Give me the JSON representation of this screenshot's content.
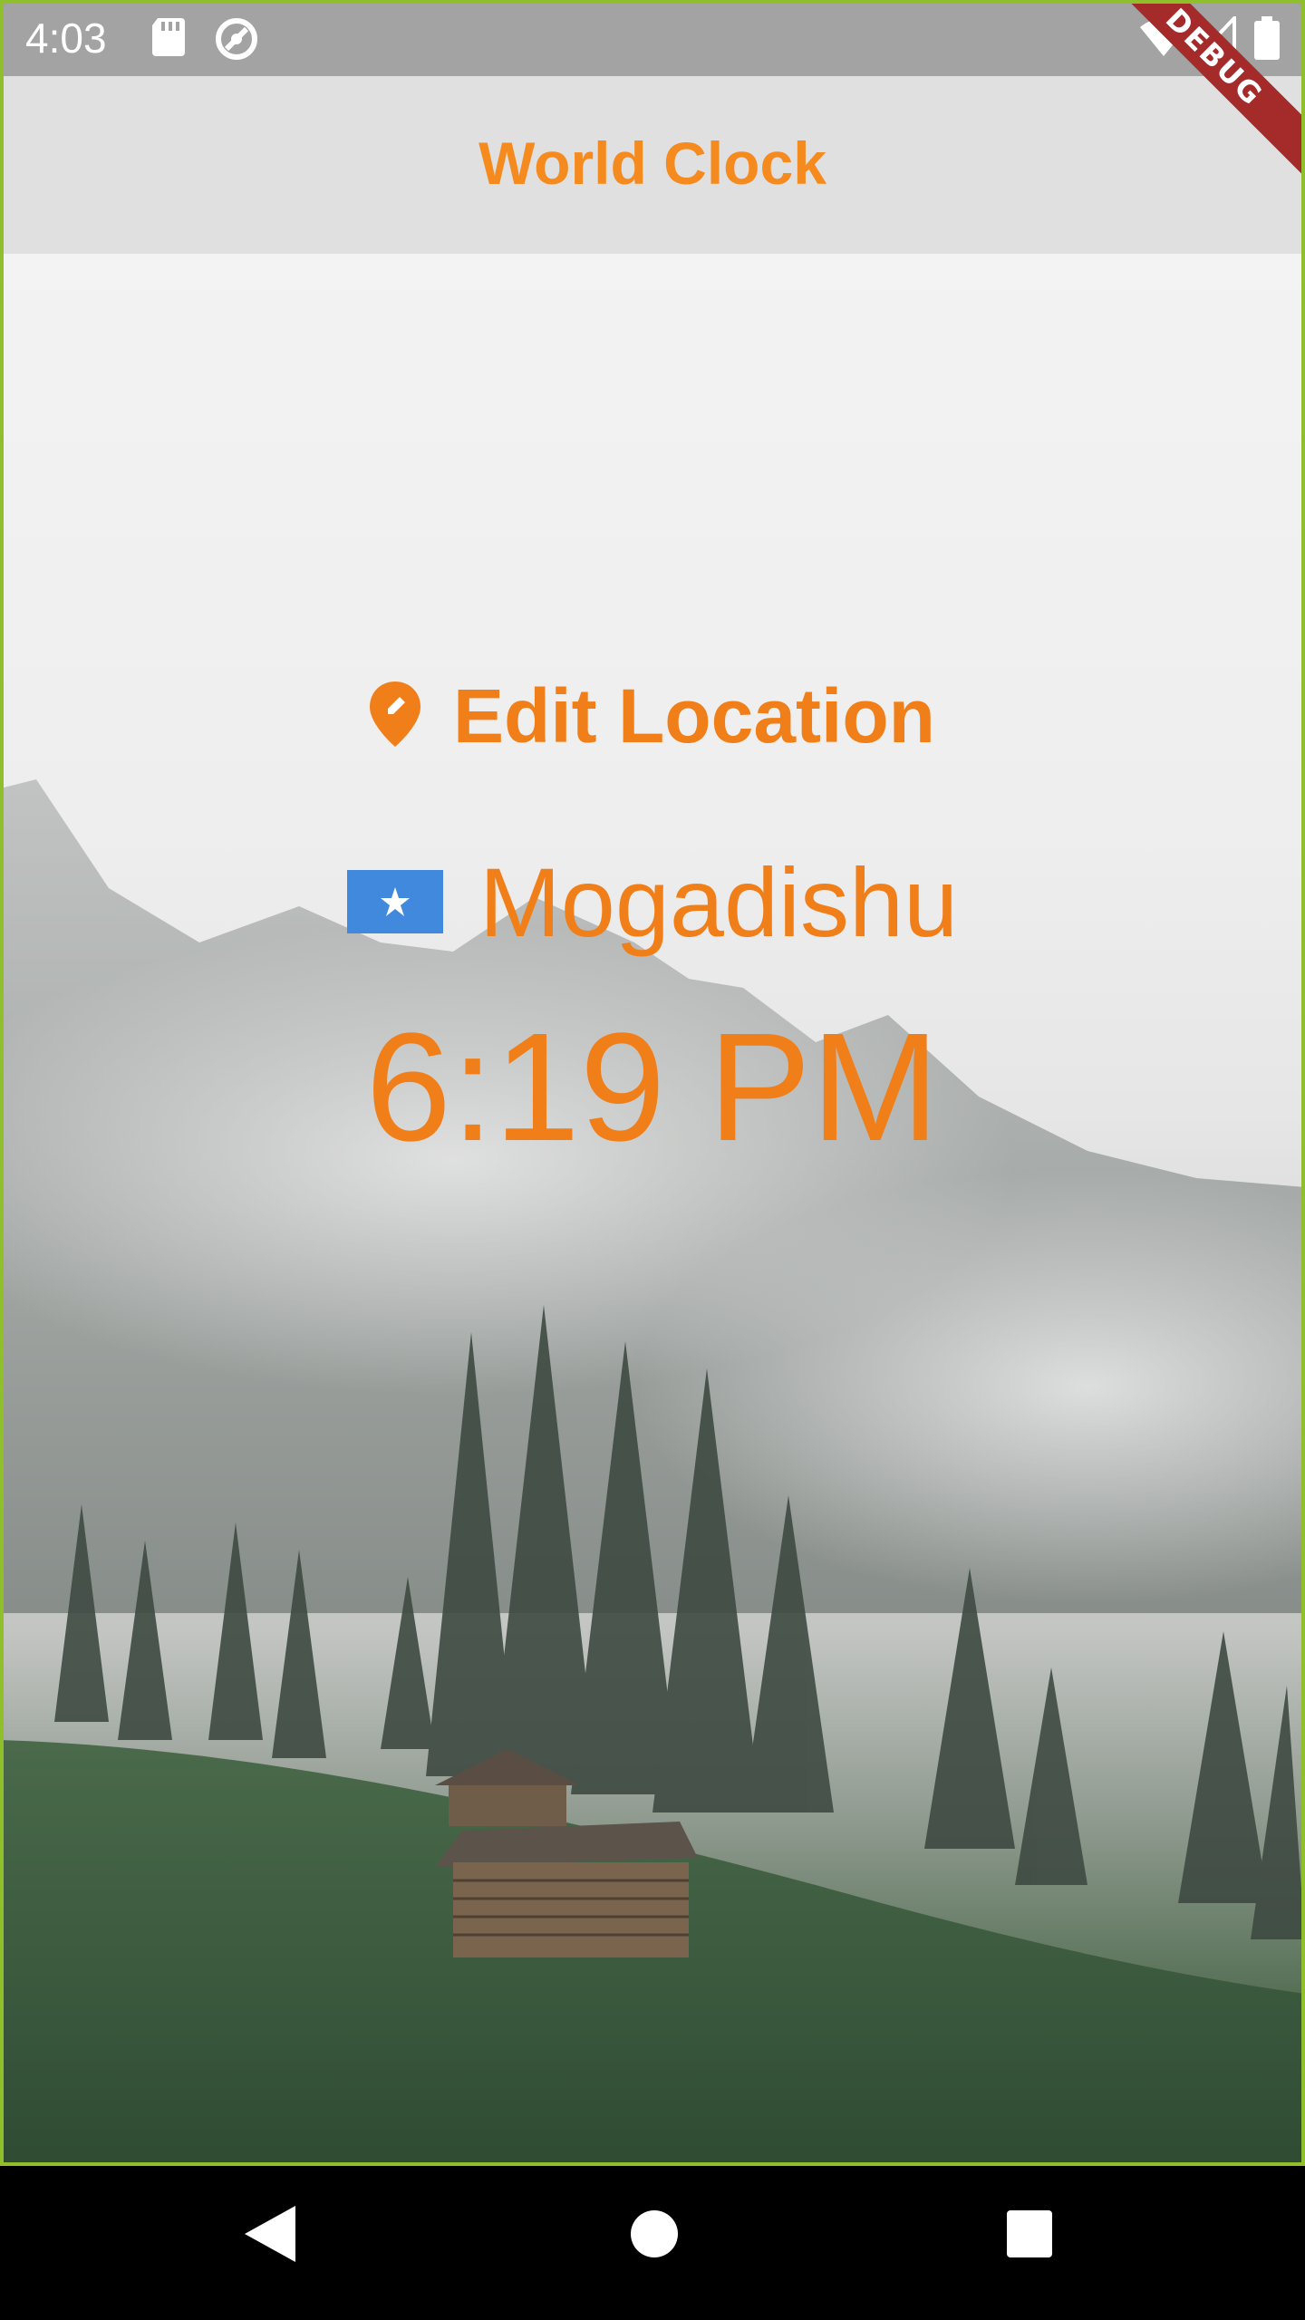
{
  "status_bar": {
    "time": "4:03",
    "icons": [
      "sd-card-icon",
      "sync-icon",
      "wifi-icon",
      "signal-icon",
      "battery-icon"
    ]
  },
  "app_bar": {
    "title": "World Clock"
  },
  "main": {
    "edit_location_label": "Edit Location",
    "location_name": "Mogadishu",
    "flag": "somalia-flag",
    "time": "6:19 PM"
  },
  "debug_banner": "DEBUG",
  "nav_bar": {
    "buttons": [
      "back-icon",
      "home-icon",
      "recents-icon"
    ]
  },
  "colors": {
    "accent": "#f07f1a",
    "app_bar_bg": "#e0e0e0",
    "status_bar_bg": "#a3a3a3",
    "flag_blue": "#4189dd",
    "debug_red": "#a52a2a"
  }
}
